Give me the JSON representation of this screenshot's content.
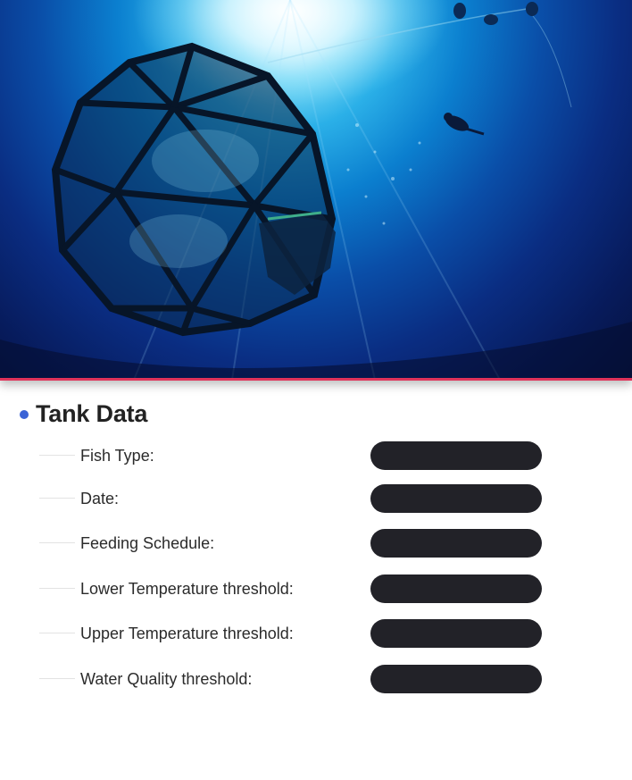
{
  "hero": {
    "image": "underwater-geodesic-fish-cage-photo"
  },
  "section": {
    "title": "Tank Data"
  },
  "fields": [
    {
      "label": "Fish Type:",
      "value": ""
    },
    {
      "label": "Date:",
      "value": ""
    },
    {
      "label": "Feeding Schedule:",
      "value": ""
    },
    {
      "label": "Lower Temperature threshold:",
      "value": ""
    },
    {
      "label": "Upper Temperature threshold:",
      "value": ""
    },
    {
      "label": "Water Quality threshold:",
      "value": ""
    }
  ],
  "colors": {
    "accent_line": "#e0335a",
    "bullet": "#3a63d6",
    "input_bg": "#222228"
  }
}
